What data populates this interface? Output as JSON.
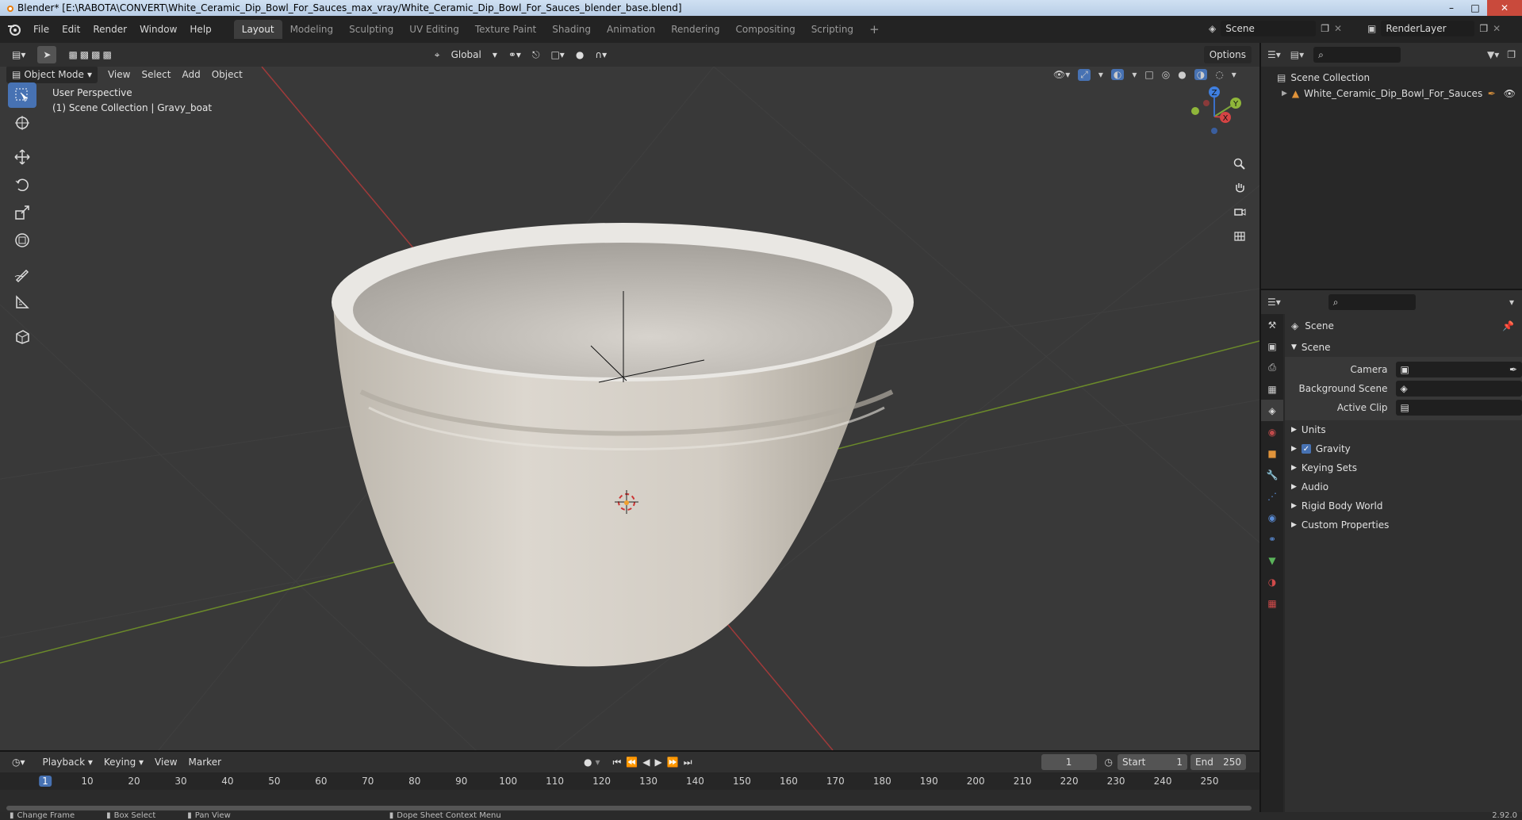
{
  "window": {
    "title": "Blender* [E:\\RABOTA\\CONVERT\\White_Ceramic_Dip_Bowl_For_Sauces_max_vray/White_Ceramic_Dip_Bowl_For_Sauces_blender_base.blend]"
  },
  "menubar": {
    "items": [
      "File",
      "Edit",
      "Render",
      "Window",
      "Help"
    ]
  },
  "workspaces": {
    "tabs": [
      "Layout",
      "Modeling",
      "Sculpting",
      "UV Editing",
      "Texture Paint",
      "Shading",
      "Animation",
      "Rendering",
      "Compositing",
      "Scripting"
    ],
    "active": "Layout",
    "add": "+"
  },
  "scene_selector": {
    "value": "Scene"
  },
  "render_layer": {
    "value": "RenderLayer"
  },
  "viewport_header": {
    "mode": "Object Mode",
    "menus": [
      "View",
      "Select",
      "Add",
      "Object"
    ],
    "orientation": "Global",
    "options": "Options"
  },
  "viewport": {
    "perspective": "User Perspective",
    "collection_info": "(1) Scene Collection | Gravy_boat"
  },
  "gizmo": {
    "x": "X",
    "y": "Y",
    "z": "Z"
  },
  "outliner": {
    "root": "Scene Collection",
    "items": [
      {
        "label": "White_Ceramic_Dip_Bowl_For_Sauces"
      }
    ]
  },
  "properties": {
    "context": "Scene",
    "panel_title": "Scene",
    "fields": [
      {
        "label": "Camera",
        "value": ""
      },
      {
        "label": "Background Scene",
        "value": ""
      },
      {
        "label": "Active Clip",
        "value": ""
      }
    ],
    "subpanels": [
      "Units",
      "Gravity",
      "Keying Sets",
      "Audio",
      "Rigid Body World",
      "Custom Properties"
    ],
    "gravity_checked": true
  },
  "timeline": {
    "menus": [
      "Playback",
      "Keying",
      "View",
      "Marker"
    ],
    "current_frame": "1",
    "start_label": "Start",
    "start": "1",
    "end_label": "End",
    "end": "250",
    "ticks": [
      "1",
      "10",
      "20",
      "30",
      "40",
      "50",
      "60",
      "70",
      "80",
      "90",
      "100",
      "110",
      "120",
      "130",
      "140",
      "150",
      "160",
      "170",
      "180",
      "190",
      "200",
      "210",
      "220",
      "230",
      "240",
      "250"
    ]
  },
  "statusbar": {
    "items": [
      "Change Frame",
      "Box Select",
      "Pan View",
      "Dope Sheet Context Menu"
    ],
    "version": "2.92.0"
  }
}
